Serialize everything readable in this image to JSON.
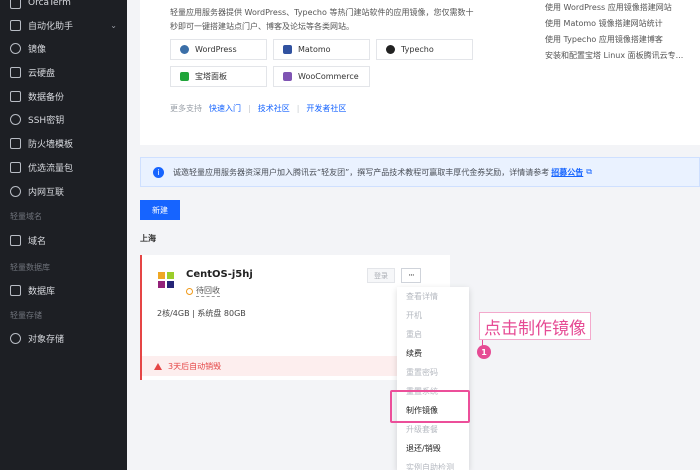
{
  "sidebar": {
    "top_item": "OrcaTerm",
    "items": [
      {
        "label": "自动化助手",
        "has_chevron": true
      },
      {
        "label": "镜像"
      },
      {
        "label": "云硬盘"
      },
      {
        "label": "数据备份"
      },
      {
        "label": "SSH密钥"
      },
      {
        "label": "防火墙模板"
      },
      {
        "label": "优选流量包"
      },
      {
        "label": "内网互联"
      }
    ],
    "section_domain": "轻量域名",
    "domain_item": "域名",
    "section_db": "轻量数据库",
    "db_item": "数据库",
    "section_storage": "轻量存储",
    "storage_item": "对象存储"
  },
  "intro": {
    "text": "轻量应用服务器提供 WordPress、Typecho 等热门建站软件的应用镜像，您仅需数十秒即可一键搭建站点门户、博客及论坛等各类网站。"
  },
  "apps": [
    {
      "label": "WordPress",
      "color": "#3b6fa8"
    },
    {
      "label": "Matomo",
      "color": "#3152a0"
    },
    {
      "label": "Typecho",
      "color": "#222222"
    },
    {
      "label": "宝塔面板",
      "color": "#20a53a"
    },
    {
      "label": "WooCommerce",
      "color": "#7f54b3"
    }
  ],
  "more_support": {
    "muted": "更多支持",
    "links": [
      "快速入门",
      "技术社区",
      "开发者社区"
    ]
  },
  "right_links": [
    "使用 WordPress 应用镜像搭建网站",
    "使用 Matomo 镜像搭建网站统计",
    "使用 Typecho 应用镜像搭建博客",
    "安装和配置宝塔 Linux 面板腾讯云专..."
  ],
  "notice": {
    "text": "诚邀轻量应用服务器资深用户加入腾讯云“轻友团”，撰写产品技术教程可赢取丰厚代金券奖励，详情请参考",
    "link": "招募公告"
  },
  "new_button": "新建",
  "region": "上海",
  "instance": {
    "name": "CentOS-j5hj",
    "status": "待回收",
    "spec": "2核/4GB   |   系统盘 80GB",
    "login": "登录",
    "more": "···",
    "warning": "3天后自动销毁",
    "renew": "续"
  },
  "dropdown": [
    {
      "label": "查看详情",
      "enabled": false
    },
    {
      "label": "开机",
      "enabled": false
    },
    {
      "label": "重启",
      "enabled": false
    },
    {
      "label": "续费",
      "enabled": true
    },
    {
      "label": "重置密码",
      "enabled": false
    },
    {
      "label": "重置系统",
      "enabled": false
    },
    {
      "label": "制作镜像",
      "enabled": true
    },
    {
      "label": "升级套餐",
      "enabled": false
    },
    {
      "label": "退还/销毁",
      "enabled": true
    },
    {
      "label": "实例自助检测",
      "enabled": false
    }
  ],
  "annotation": {
    "label": "点击制作镜像",
    "badge": "1"
  },
  "colors": {
    "accent": "#1664ff",
    "danger": "#e54545",
    "annotation": "#e64b94",
    "sidebar_bg": "#1d1f24"
  }
}
